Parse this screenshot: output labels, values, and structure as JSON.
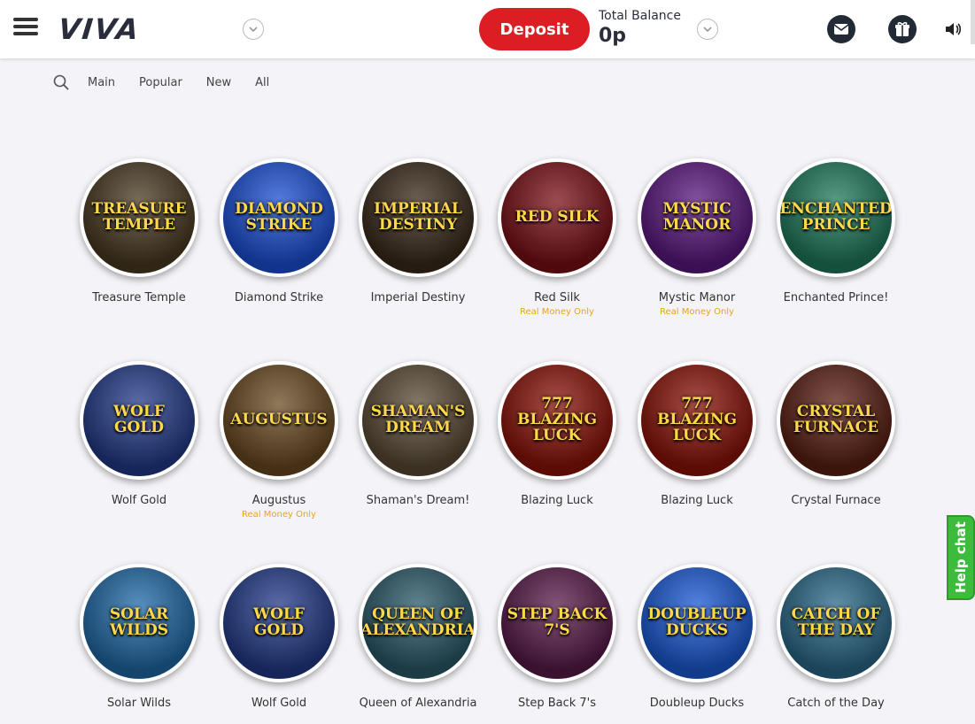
{
  "header": {
    "logo": "VIVA",
    "deposit_label": "Deposit",
    "balance_label": "Total Balance",
    "balance_value": "0p"
  },
  "filters": [
    "Main",
    "Popular",
    "New",
    "All"
  ],
  "games": [
    {
      "name": "Treasure Temple",
      "art": "Treasure Temple",
      "tag": "",
      "bg": "#4a3a22"
    },
    {
      "name": "Diamond Strike",
      "art": "Diamond Strike",
      "tag": "",
      "bg": "#1b4fd6"
    },
    {
      "name": "Imperial Destiny",
      "art": "Imperial Destiny",
      "tag": "",
      "bg": "#3a2a1a"
    },
    {
      "name": "Red Silk",
      "art": "Red Silk",
      "tag": "Real Money Only",
      "bg": "#7a0f16"
    },
    {
      "name": "Mystic Manor",
      "art": "Mystic Manor",
      "tag": "Real Money Only",
      "bg": "#5b1780"
    },
    {
      "name": "Enchanted Prince!",
      "art": "Enchanted Prince",
      "tag": "",
      "bg": "#1e7a5a"
    },
    {
      "name": "Wolf Gold",
      "art": "Wolf Gold",
      "tag": "",
      "bg": "#223b8a"
    },
    {
      "name": "Augustus",
      "art": "Augustus",
      "tag": "Real Money Only",
      "bg": "#6a4a22"
    },
    {
      "name": "Shaman's Dream!",
      "art": "Shaman's Dream",
      "tag": "",
      "bg": "#5a4a34"
    },
    {
      "name": "Blazing Luck",
      "art": "777 Blazing Luck",
      "tag": "",
      "bg": "#8a1208"
    },
    {
      "name": "Blazing Luck",
      "art": "777 Blazing Luck",
      "tag": "",
      "bg": "#8a1208"
    },
    {
      "name": "Crystal Furnace",
      "art": "Crystal Furnace",
      "tag": "",
      "bg": "#5a1e12"
    },
    {
      "name": "Solar Wilds",
      "art": "Solar Wilds",
      "tag": "",
      "bg": "#1f6aa8"
    },
    {
      "name": "Wolf Gold",
      "art": "Wolf Gold",
      "tag": "",
      "bg": "#223b8a"
    },
    {
      "name": "Queen of Alexandria",
      "art": "Queen of Alexandria",
      "tag": "",
      "bg": "#2a5a6a"
    },
    {
      "name": "Step Back 7's",
      "art": "Step Back 7's",
      "tag": "",
      "bg": "#5a1a4a"
    },
    {
      "name": "Doubleup Ducks",
      "art": "Doubleup Ducks",
      "tag": "",
      "bg": "#1a5ad6"
    },
    {
      "name": "Catch of the Day",
      "art": "Catch of the Day",
      "tag": "",
      "bg": "#2a6a8a"
    }
  ],
  "help_chat_label": "Help chat",
  "colors": {
    "deposit": "#dc1d24",
    "help_chat": "#3dbb3c",
    "tag": "#e8a31a"
  }
}
